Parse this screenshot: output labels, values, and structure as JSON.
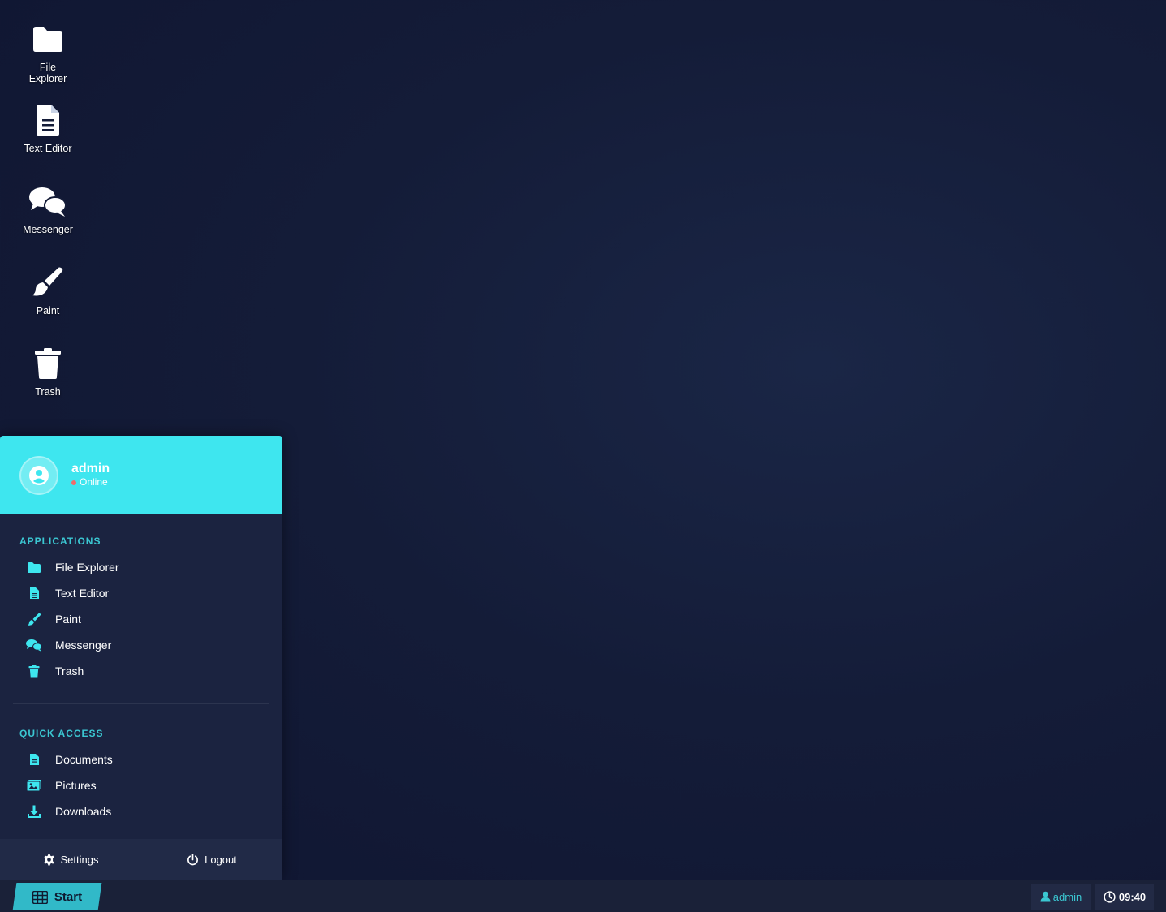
{
  "desktop": {
    "icons": [
      {
        "label": "File Explorer",
        "icon": "folder-icon"
      },
      {
        "label": "Text Editor",
        "icon": "document-icon"
      },
      {
        "label": "Messenger",
        "icon": "chat-icon"
      },
      {
        "label": "Paint",
        "icon": "paintbrush-icon"
      },
      {
        "label": "Trash",
        "icon": "trash-icon"
      }
    ]
  },
  "start_menu": {
    "user": {
      "name": "admin",
      "status": "Online"
    },
    "applications": {
      "title": "APPLICATIONS",
      "items": [
        {
          "label": "File Explorer",
          "icon": "folder-icon"
        },
        {
          "label": "Text Editor",
          "icon": "document-icon"
        },
        {
          "label": "Paint",
          "icon": "paintbrush-icon"
        },
        {
          "label": "Messenger",
          "icon": "chat-icon"
        },
        {
          "label": "Trash",
          "icon": "trash-icon"
        }
      ]
    },
    "quick_access": {
      "title": "QUICK ACCESS",
      "items": [
        {
          "label": "Documents",
          "icon": "document-icon"
        },
        {
          "label": "Pictures",
          "icon": "pictures-icon"
        },
        {
          "label": "Downloads",
          "icon": "download-icon"
        }
      ]
    },
    "footer": {
      "settings_label": "Settings",
      "logout_label": "Logout"
    }
  },
  "taskbar": {
    "start_label": "Start",
    "user_label": "admin",
    "clock": "09:40"
  },
  "colors": {
    "accent": "#3ee6ef",
    "accent_text": "#3bc7d2",
    "menu_bg": "#1b2340",
    "desktop_bg": "#141c38"
  }
}
